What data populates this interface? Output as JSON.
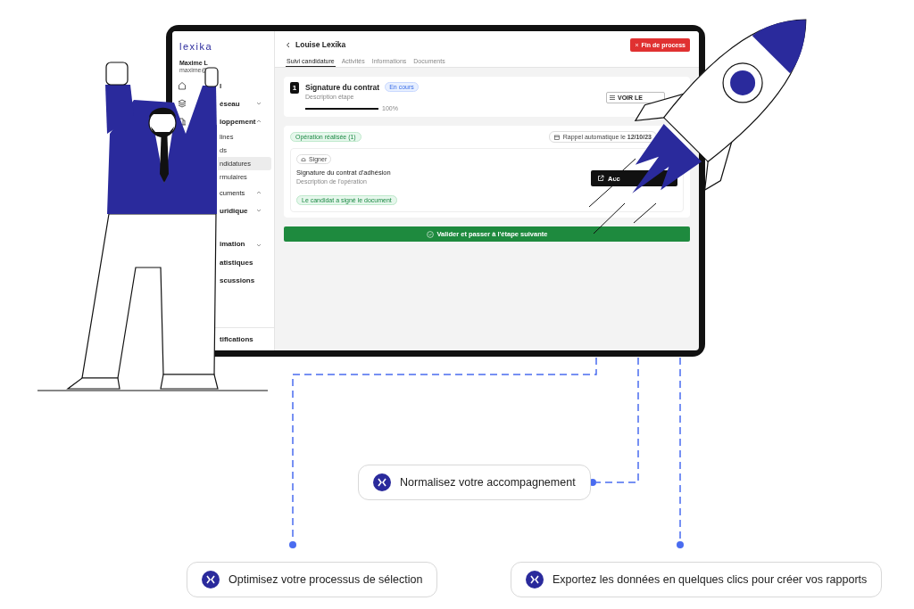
{
  "app": {
    "brand": "lexika",
    "user": {
      "name": "Maxime L",
      "email": "maxime@"
    }
  },
  "sidebar": {
    "items": [
      {
        "label": "l"
      },
      {
        "label": "éseau",
        "expanded": false
      },
      {
        "label": "loppement",
        "expanded": true,
        "children": [
          {
            "label": "lines",
            "selected": false
          },
          {
            "label": "ds",
            "selected": false
          },
          {
            "label": "ndidatures",
            "selected": true
          },
          {
            "label": "rmulaires",
            "selected": false
          }
        ]
      },
      {
        "label": "cuments",
        "expanded": true
      },
      {
        "label": "uridique",
        "expanded": false
      },
      {
        "label": "imation",
        "expanded": false
      },
      {
        "label": "atistiques"
      },
      {
        "label": "scussions"
      }
    ],
    "footer": "tifications"
  },
  "header": {
    "title": "Louise Lexika",
    "end_button": "Fin de process",
    "tabs": [
      {
        "label": "Suivi candidature",
        "selected": true
      },
      {
        "label": "Activités",
        "selected": false
      },
      {
        "label": "Informations",
        "selected": false
      },
      {
        "label": "Documents",
        "selected": false
      }
    ]
  },
  "step": {
    "number": "1",
    "title": "Signature du contrat",
    "badge": "En cours",
    "description": "Description étape",
    "level": 1,
    "percent": "100%",
    "button": "VOIR LE"
  },
  "operations": {
    "badge": "Opération réalisée (1)",
    "reminder": "Rappel automatique le **12/10/23**",
    "items": [
      {
        "tag": "Signer",
        "title": "Signature du contrat d'adhésion",
        "description": "Description de l'opération",
        "status": "Le candidat a signé le document",
        "button": "Acc"
      }
    ]
  },
  "next_button": "Valider et passer à l'étape suivante",
  "callouts": [
    {
      "text": "Normalisez votre accompagnement"
    },
    {
      "text": "Optimisez votre processus de sélection"
    },
    {
      "text": "Exportez les données en quelques clics pour créer vos rapports"
    }
  ]
}
